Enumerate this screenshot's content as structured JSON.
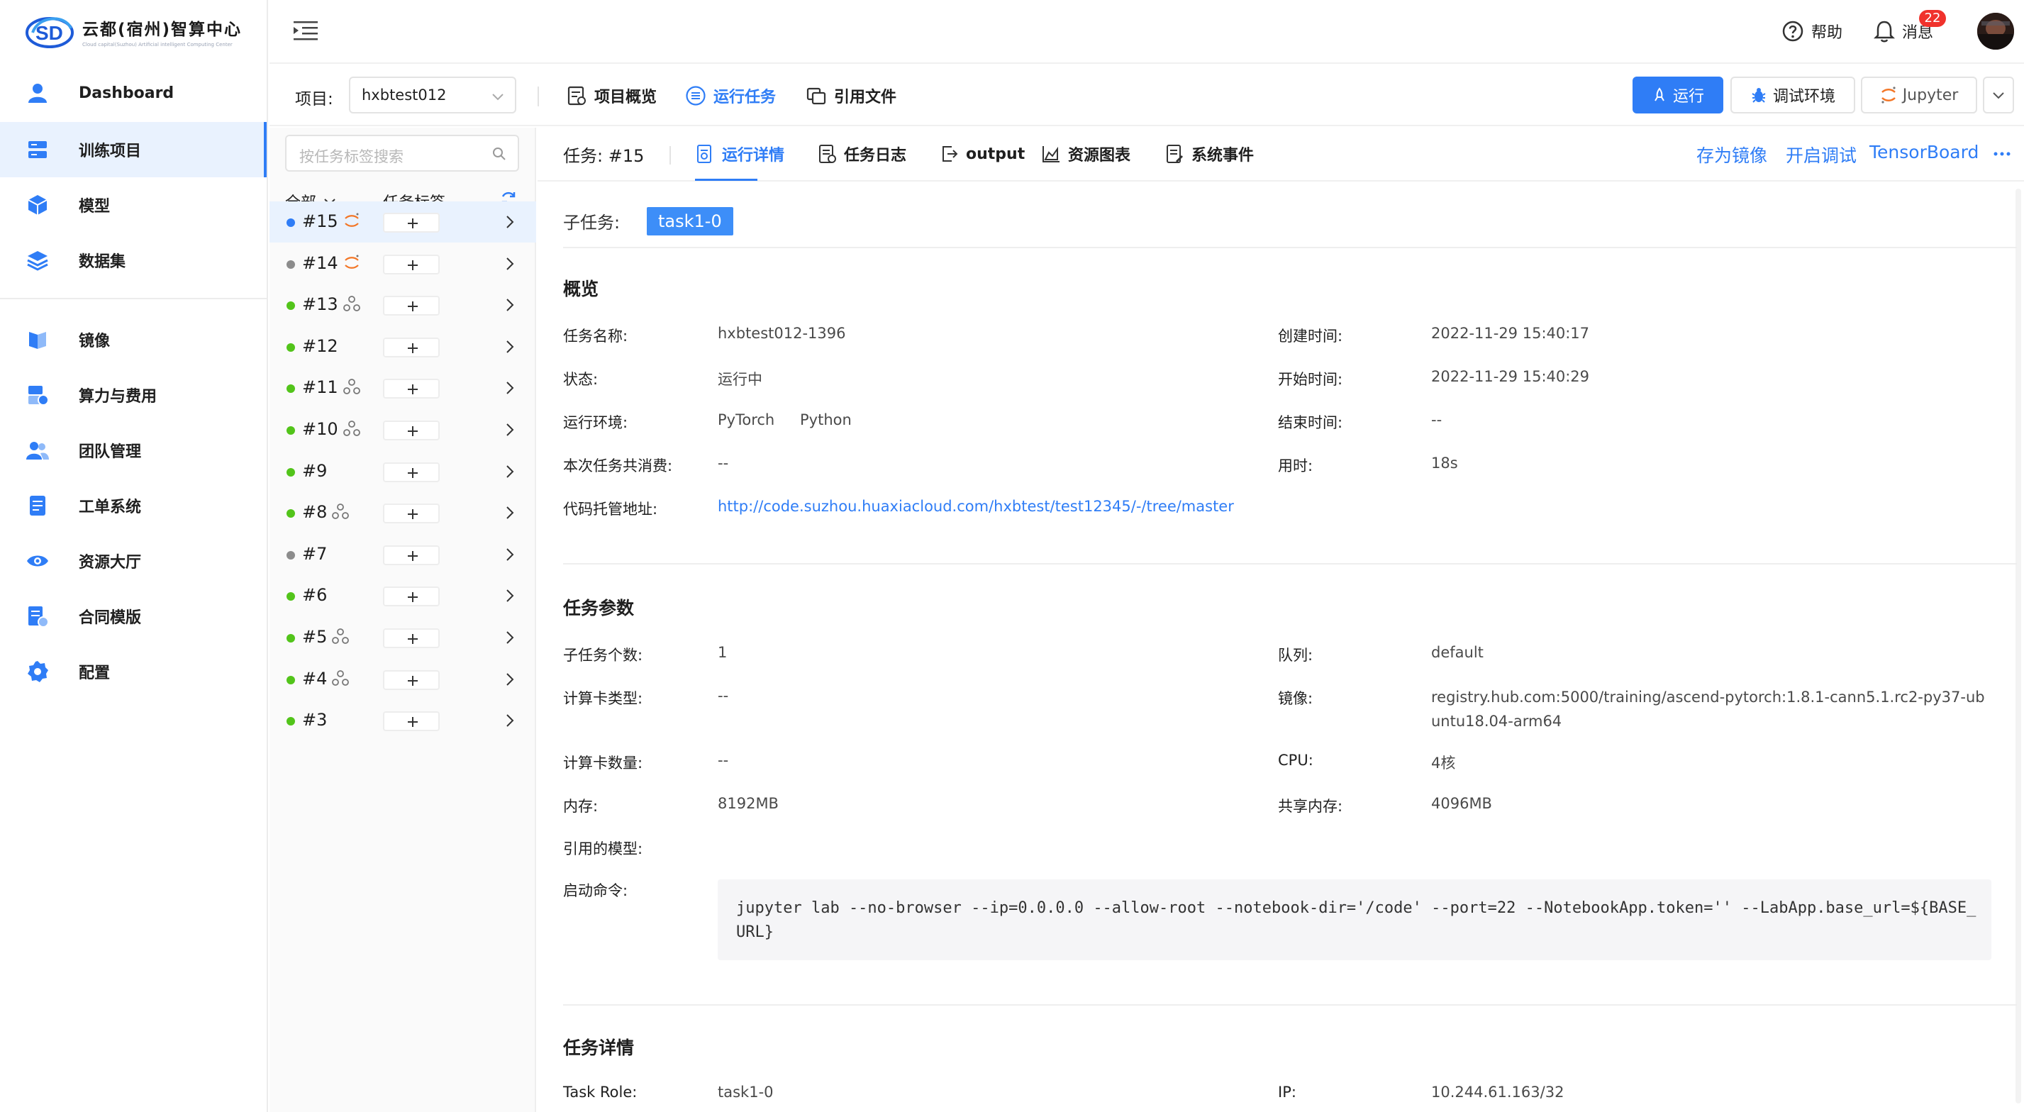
{
  "brand": {
    "name": "云都(宿州)智算中心",
    "subtitle": "Cloud capital(Suzhou) Artificial intelligent Computing Center"
  },
  "sidebar": {
    "items": [
      {
        "label": "Dashboard",
        "icon": "user-icon"
      },
      {
        "label": "训练项目",
        "icon": "server-icon",
        "active": true
      },
      {
        "label": "模型",
        "icon": "cube-icon"
      },
      {
        "label": "数据集",
        "icon": "layers-icon"
      },
      {
        "label": "镜像",
        "icon": "image-icon"
      },
      {
        "label": "算力与费用",
        "icon": "billing-icon"
      },
      {
        "label": "团队管理",
        "icon": "team-icon"
      },
      {
        "label": "工单系统",
        "icon": "ticket-icon"
      },
      {
        "label": "资源大厅",
        "icon": "eye-icon"
      },
      {
        "label": "合同模版",
        "icon": "contract-icon"
      },
      {
        "label": "配置",
        "icon": "settings-icon"
      }
    ]
  },
  "header": {
    "help_label": "帮助",
    "messages_label": "消息",
    "messages_count": "22"
  },
  "project_bar": {
    "label": "项目:",
    "selected_project": "hxbtest012",
    "tabs": [
      {
        "label": "项目概览",
        "active": false
      },
      {
        "label": "运行任务",
        "active": true
      },
      {
        "label": "引用文件",
        "active": false
      }
    ],
    "buttons": {
      "run": "运行",
      "debug_env": "调试环境",
      "jupyter": "Jupyter"
    }
  },
  "task_list": {
    "search_placeholder": "按任务标签搜索",
    "filter_all": "全部",
    "filter_tag": "任务标签",
    "tasks": [
      {
        "id": "#15",
        "status": "running",
        "tag": "jupyter",
        "active": true
      },
      {
        "id": "#14",
        "status": "stopped",
        "tag": "jupyter"
      },
      {
        "id": "#13",
        "status": "running",
        "tag": "distributed"
      },
      {
        "id": "#12",
        "status": "running",
        "tag": ""
      },
      {
        "id": "#11",
        "status": "running",
        "tag": "distributed"
      },
      {
        "id": "#10",
        "status": "running",
        "tag": "distributed"
      },
      {
        "id": "#9",
        "status": "running",
        "tag": ""
      },
      {
        "id": "#8",
        "status": "running",
        "tag": "distributed"
      },
      {
        "id": "#7",
        "status": "stopped",
        "tag": ""
      },
      {
        "id": "#6",
        "status": "running",
        "tag": ""
      },
      {
        "id": "#5",
        "status": "running",
        "tag": "distributed"
      },
      {
        "id": "#4",
        "status": "running",
        "tag": "distributed"
      },
      {
        "id": "#3",
        "status": "running",
        "tag": ""
      }
    ],
    "status_colors": {
      "running": "#52c41a",
      "stopped": "#8c8c8c",
      "selected": "#2f7df6"
    }
  },
  "detail": {
    "task_label": "任务:",
    "task_id": "#15",
    "tabs": [
      {
        "label": "运行详情",
        "active": true
      },
      {
        "label": "任务日志"
      },
      {
        "label": "output"
      },
      {
        "label": "资源图表"
      },
      {
        "label": "系统事件"
      }
    ],
    "actions": {
      "save_image": "存为镜像",
      "start_debug": "开启调试",
      "tensorboard": "TensorBoard"
    },
    "subtask_label": "子任务:",
    "subtask_value": "task1-0",
    "overview": {
      "title": "概览",
      "name_label": "任务名称:",
      "name_value": "hxbtest012-1396",
      "status_label": "状态:",
      "status_value": "运行中",
      "env_label": "运行环境:",
      "env_value_1": "PyTorch",
      "env_value_2": "Python",
      "cost_label": "本次任务共消费:",
      "cost_value": "--",
      "repo_label": "代码托管地址:",
      "repo_value": "http://code.suzhou.huaxiacloud.com/hxbtest/test12345/-/tree/master",
      "created_label": "创建时间:",
      "created_value": "2022-11-29 15:40:17",
      "started_label": "开始时间:",
      "started_value": "2022-11-29 15:40:29",
      "ended_label": "结束时间:",
      "ended_value": "--",
      "duration_label": "用时:",
      "duration_value": "18s"
    },
    "params": {
      "title": "任务参数",
      "subtask_count_label": "子任务个数:",
      "subtask_count_value": "1",
      "card_type_label": "计算卡类型:",
      "card_type_value": "--",
      "card_count_label": "计算卡数量:",
      "card_count_value": "--",
      "memory_label": "内存:",
      "memory_value": "8192MB",
      "models_label": "引用的模型:",
      "command_label": "启动命令:",
      "command_value": "jupyter lab --no-browser --ip=0.0.0.0 --allow-root --notebook-dir='/code' --port=22 --NotebookApp.token='' --LabApp.base_url=${BASE_URL}",
      "queue_label": "队列:",
      "queue_value": "default",
      "image_label": "镜像:",
      "image_value": "registry.hub.com:5000/training/ascend-pytorch:1.8.1-cann5.1.rc2-py37-ubuntu18.04-arm64",
      "cpu_label": "CPU:",
      "cpu_value": "4核",
      "shm_label": "共享内存:",
      "shm_value": "4096MB"
    },
    "task_detail": {
      "title": "任务详情",
      "role_label": "Task Role:",
      "role_value": "task1-0",
      "ip_label": "IP:",
      "ip_value": "10.244.61.163/32"
    }
  },
  "colors": {
    "accent": "#2f7df6",
    "badge": "#f0322c",
    "active_bg": "#e9f2fe"
  }
}
